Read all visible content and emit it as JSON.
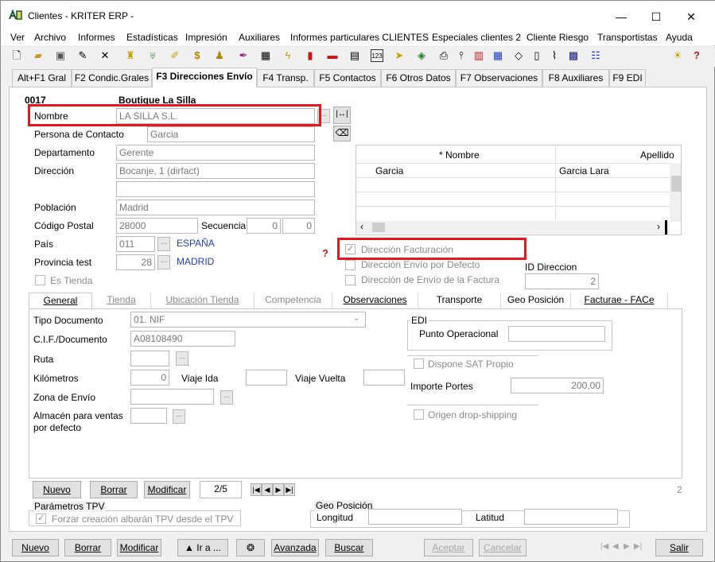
{
  "window": {
    "title": "Clientes - KRITER ERP -",
    "minimize": "—",
    "maximize": "☐",
    "close": "✕"
  },
  "menu": [
    "Ver",
    "Archivo",
    "Informes",
    "Estadísticas",
    "Impresión",
    "Auxiliares",
    "Informes particulares CLIENTES",
    "Especiales clientes 2",
    "Cliente Riesgo",
    "Transportistas",
    "Ayuda"
  ],
  "toolbar_icons": [
    "new-document-icon",
    "open-folder-icon",
    "save-icon",
    "edit-icon",
    "delete-icon",
    "users-icon",
    "filter-icon",
    "pencil-icon",
    "money-icon",
    "stamp-icon",
    "brush-icon",
    "calculator-icon",
    "lightning-icon",
    "chart-icon",
    "briefcase-icon",
    "card-icon",
    "numbers-icon",
    "truck-icon",
    "map-icon",
    "printer-icon",
    "attach-icon",
    "building-icon",
    "calendar-icon",
    "tag-icon",
    "notes-icon",
    "clip-icon",
    "grid-icon",
    "list-icon",
    "lightbulb-icon",
    "help-icon"
  ],
  "tabs": [
    "Alt+F1 Gral",
    "F2 Condic.Grales",
    "F3 Direcciones Envío",
    "F4 Transp.",
    "F5 Contactos",
    "F6 Otros Datos",
    "F7 Observaciones",
    "F8 Auxiliares",
    "F9 EDI"
  ],
  "header": {
    "code": "0017",
    "name": "Boutique La Silla"
  },
  "form": {
    "nombre_label": "Nombre",
    "nombre": "LA SILLA S.L.",
    "contacto_label": "Persona de Contacto",
    "contacto": "Garcia",
    "departamento_label": "Departamento",
    "departamento": "Gerente",
    "direccion_label": "Dirección",
    "direccion": "Bocanje, 1 (dirfact)",
    "poblacion_label": "Población",
    "poblacion": "Madrid",
    "cp_label": "Código Postal",
    "cp": "28000",
    "secuencia_label": "Secuencia",
    "secuencia1": "0",
    "secuencia2": "0",
    "pais_label": "País",
    "pais": "011",
    "pais_name": "ESPAÑA",
    "provincia_label": "Provincia test",
    "provincia": "28",
    "provincia_name": "MADRID",
    "es_tienda": "Es Tienda"
  },
  "grid": {
    "col1": "* Nombre",
    "col2": "Apellido",
    "rows": [
      [
        "Garcia",
        "Garcia Lara"
      ]
    ]
  },
  "checks": {
    "facturacion": "Dirección Facturación",
    "envio_defecto": "Dirección Envío por Defecto",
    "envio_factura": "Dirección de Envío de la Factura",
    "id_label": "ID Direccion",
    "id_value": "2"
  },
  "subtabs": [
    "General",
    "Tienda",
    "Ubicación Tienda",
    "Competencia",
    "Observaciones",
    "Transporte",
    "Geo Posición",
    "Facturae - FACe"
  ],
  "general": {
    "tipo_doc_label": "Tipo Documento",
    "tipo_doc": "01. NIF",
    "cif_label": "C.I.F./Documento",
    "cif": "A08108490",
    "ruta_label": "Ruta",
    "km_label": "Kilómetros",
    "km": "0",
    "viaje_ida_label": "Viaje Ida",
    "viaje_vuelta_label": "Viaje Vuelta",
    "zona_label": "Zona de Envío",
    "almacen_label": "Almacén para ventas por defecto",
    "edi_label": "EDI",
    "punto_label": "Punto Operacional",
    "sat_label": "Dispone SAT Propio",
    "portes_label": "Importe Portes",
    "portes": "200,00",
    "drop_label": "Origen drop-shipping"
  },
  "nav": {
    "nuevo": "Nuevo",
    "borrar": "Borrar",
    "modificar": "Modificar",
    "page": "2/5",
    "count": "2"
  },
  "tpv": {
    "title": "Parámetros TPV",
    "forzar": "Forzar creación albarán TPV desde el TPV"
  },
  "geo": {
    "title": "Geo Posición",
    "longitud": "Longitud",
    "latitud": "Latitud"
  },
  "bottom": {
    "nuevo": "Nuevo",
    "borrar": "Borrar",
    "modificar": "Modificar",
    "ira": "▲ Ir a ...",
    "avanzada": "Avanzada",
    "buscar": "Buscar",
    "aceptar": "Aceptar",
    "cancelar": "Cancelar",
    "salir": "Salir"
  }
}
